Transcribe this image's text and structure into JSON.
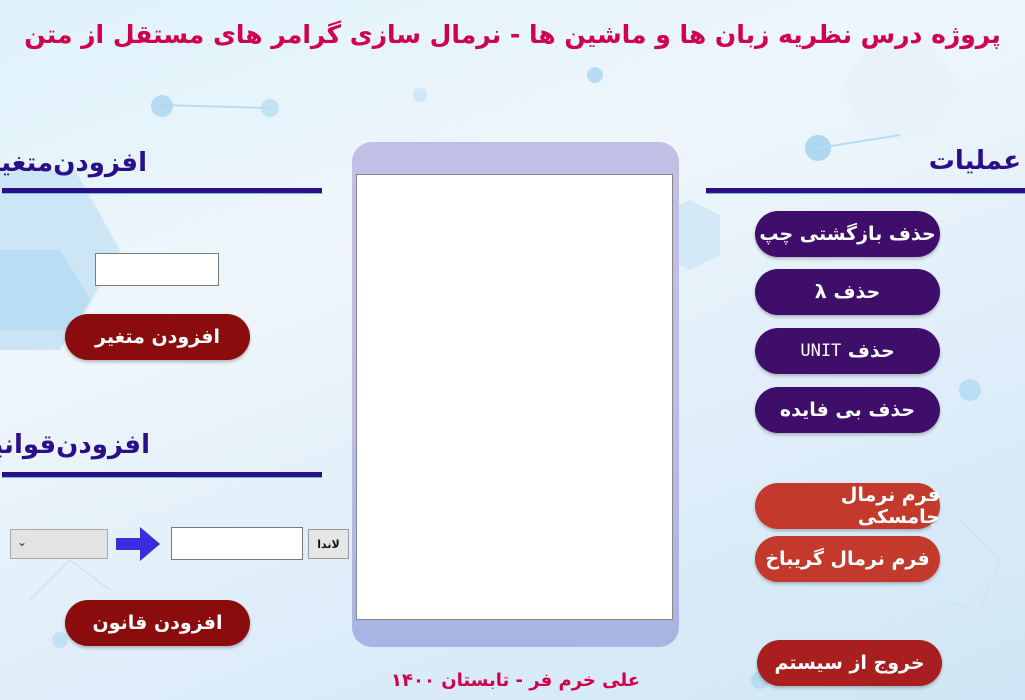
{
  "header": {
    "title": "پروژه درس نظریه زبان ها و ماشین ها - نرمال سازی گرامر های مستقل از متن"
  },
  "add_variable": {
    "section_title": "افزودن‌متغیر",
    "input_value": "",
    "button_label": "افزودن متغیر"
  },
  "add_rules": {
    "section_title": "افزودن‌قوانین",
    "combo_value": "",
    "rule_input_value": "",
    "lambda_button_label": "لاندا",
    "button_label": "افزودن قانون"
  },
  "operations": {
    "section_title": "عملیات",
    "left_recursion_label": "حذف بازگشتی چپ",
    "lambda_removal_prefix": "حذف",
    "lambda_symbol": "λ",
    "unit_removal_prefix": "حذف",
    "unit_word": "UNIT",
    "useless_removal_label": "حذف بی فایده",
    "chomsky_label": "فرم نرمال چامسکی",
    "greibach_label": "فرم نرمال گریباخ",
    "exit_label": "خروج از سیستم"
  },
  "grammar_list": {
    "items": []
  },
  "footer": {
    "credit": "علی خرم فر - تابستان ۱۴۰۰"
  },
  "colors": {
    "title": "#d1004d",
    "section": "#2b0f8a",
    "purple_button": "#3f0e6b",
    "red_button": "#8b0c0c",
    "orange_button": "#c3392b"
  },
  "icons": {
    "arrow": "arrow-right-icon",
    "combo": "chevron-down-icon"
  }
}
